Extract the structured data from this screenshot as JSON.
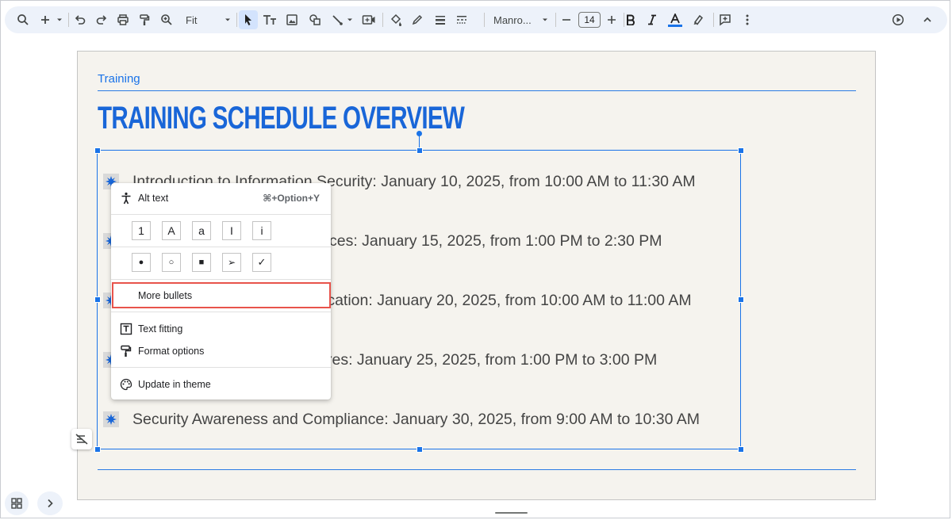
{
  "toolbar": {
    "zoom_value": "Fit",
    "font_name": "Manro...",
    "font_size": "14",
    "text_color": "#1a73e8"
  },
  "slide": {
    "kicker": "Training",
    "title": "TRAINING SCHEDULE OVERVIEW",
    "bullets": [
      "Introduction to Information Security: January 10, 2025, from 10:00 AM to 11:30 AM",
      "ces: January 15, 2025, from 1:00 PM to 2:30 PM",
      "ication: January 20, 2025, from 10:00 AM to 11:00 AM",
      "res: January 25, 2025, from 1:00 PM to 3:00 PM",
      "Security Awareness and Compliance: January 30, 2025, from 9:00 AM to 10:30 AM"
    ]
  },
  "context_menu": {
    "alt_text": {
      "label": "Alt text",
      "shortcut": "⌘+Option+Y"
    },
    "numbered_presets": [
      "1",
      "A",
      "a",
      "I",
      "i"
    ],
    "bullet_presets": [
      "●",
      "○",
      "■",
      "➢",
      "✓"
    ],
    "more_bullets": "More bullets",
    "text_fitting": "Text fitting",
    "format_options": "Format options",
    "update_in_theme": "Update in theme"
  },
  "colors": {
    "accent": "#1a73e8",
    "highlight_box": "#e8534b",
    "slide_bg": "#f5f3ee",
    "title": "#1966d8"
  }
}
